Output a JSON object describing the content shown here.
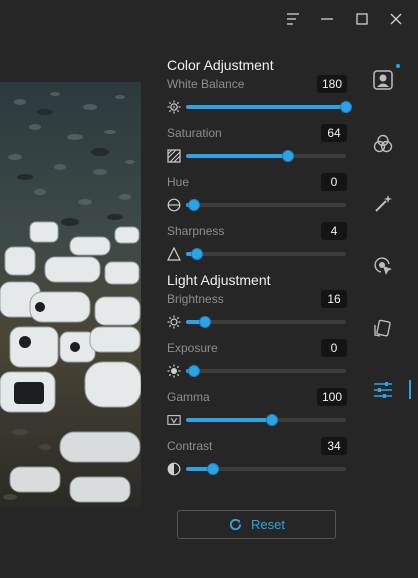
{
  "window": {
    "icons": [
      "menu-icon",
      "minimize-icon",
      "maximize-icon",
      "close-icon"
    ]
  },
  "colors": {
    "background": "#262626",
    "accent": "#2aa4e8",
    "track": "#3d3d3d",
    "value_box": "#141414",
    "label": "#8e8e8e"
  },
  "color_adjustment": {
    "title": "Color Adjustment",
    "controls": [
      {
        "label": "White Balance",
        "value": "180",
        "fraction": 1.0,
        "icon": "white-balance-icon"
      },
      {
        "label": "Saturation",
        "value": "64",
        "fraction": 0.64,
        "icon": "saturation-icon"
      },
      {
        "label": "Hue",
        "value": "0",
        "fraction": 0.05,
        "icon": "hue-icon"
      },
      {
        "label": "Sharpness",
        "value": "4",
        "fraction": 0.07,
        "icon": "sharpness-icon"
      }
    ]
  },
  "light_adjustment": {
    "title": "Light Adjustment",
    "controls": [
      {
        "label": "Brightness",
        "value": "16",
        "fraction": 0.12,
        "icon": "brightness-icon"
      },
      {
        "label": "Exposure",
        "value": "0",
        "fraction": 0.05,
        "icon": "exposure-icon"
      },
      {
        "label": "Gamma",
        "value": "100",
        "fraction": 0.54,
        "icon": "gamma-icon"
      },
      {
        "label": "Contrast",
        "value": "34",
        "fraction": 0.17,
        "icon": "contrast-icon"
      }
    ]
  },
  "reset": {
    "label": "Reset",
    "icon": "refresh-icon"
  },
  "toolbar": {
    "items": [
      {
        "icon": "portrait-icon",
        "active": false
      },
      {
        "icon": "color-circles-icon",
        "active": false
      },
      {
        "icon": "magic-wand-icon",
        "active": false
      },
      {
        "icon": "target-cursor-icon",
        "active": false
      },
      {
        "icon": "rotate-card-icon",
        "active": false
      },
      {
        "icon": "sliders-icon",
        "active": true
      }
    ]
  }
}
